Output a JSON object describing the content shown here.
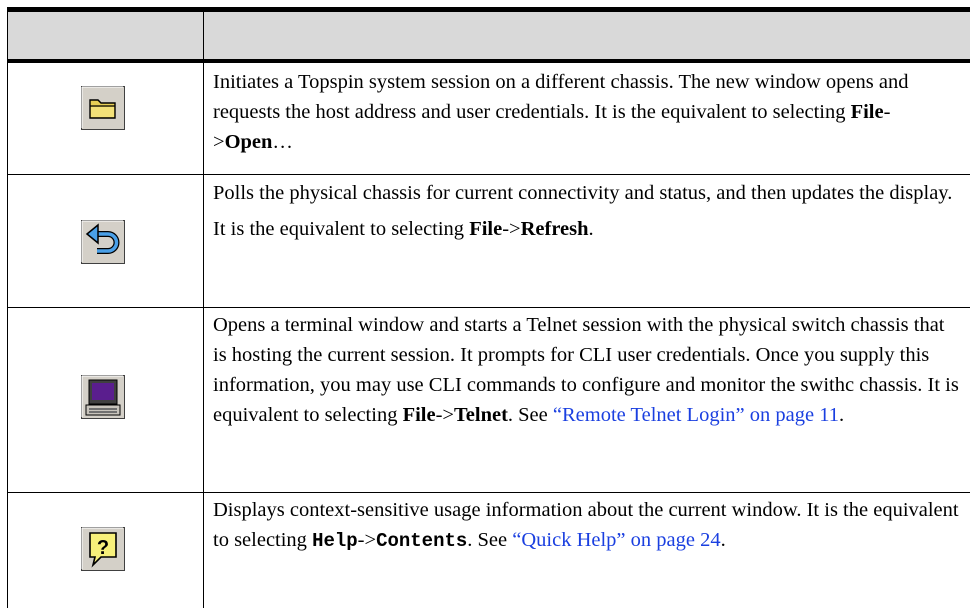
{
  "rows": [
    {
      "icon": "open-folder-icon",
      "text_before": "Initiates a Topspin system session on a different chassis. The new window  opens  and requests the host address and user credentials. It is the equivalent to selecting ",
      "menu": "File",
      "arrow": "->",
      "item": "Open",
      "text_after": "…"
    },
    {
      "icon": "refresh-arrow-icon",
      "text1": "Polls the physical chassis for current connectivity and status, and then updates the display.",
      "text2_before": "It is the equivalent to selecting ",
      "menu": "File",
      "arrow": "->",
      "item": "Refresh",
      "text2_after": "."
    },
    {
      "icon": "terminal-icon",
      "text_before": "Opens a terminal window and starts a Telnet session with the physical switch chassis that is hosting the current session. It prompts for CLI user credentials. Once you supply this information, you may use CLI commands to configure and monitor the swithc chassis. It is equivalent to selecting ",
      "menu": "File",
      "arrow": "->",
      "item": "Telnet",
      "text_mid": ". See ",
      "link": "“Remote Telnet Login” on page 11",
      "text_after": "."
    },
    {
      "icon": "help-question-icon",
      "text_before": "Displays context-sensitive usage information about the current window. It is the equivalent to selecting ",
      "menu": "Help",
      "arrow": "->",
      "item": "Contents",
      "text_mid": ". See ",
      "link": "“Quick Help” on page 24",
      "text_after": "."
    }
  ]
}
